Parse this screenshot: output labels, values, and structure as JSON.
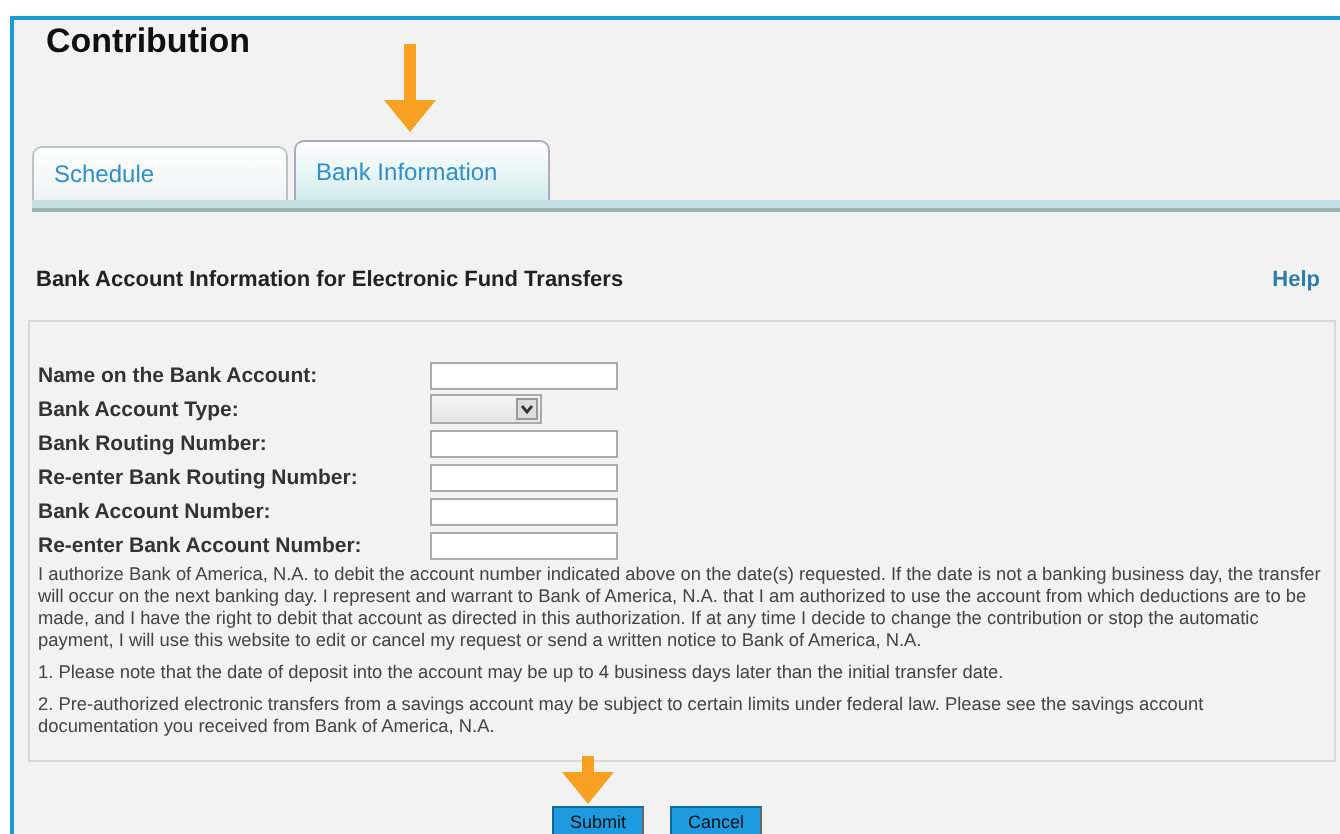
{
  "page": {
    "title": "Contribution"
  },
  "tabs": [
    {
      "label": "Schedule",
      "selected": false
    },
    {
      "label": "Bank Information",
      "selected": true
    }
  ],
  "section": {
    "heading": "Bank Account Information for Electronic Fund Transfers",
    "help": "Help"
  },
  "fields": [
    {
      "label": "Name on the Bank Account:",
      "kind": "text"
    },
    {
      "label": "Bank Account Type:",
      "kind": "select"
    },
    {
      "label": "Bank Routing Number:",
      "kind": "text"
    },
    {
      "label": "Re-enter Bank Routing Number:",
      "kind": "text"
    },
    {
      "label": "Bank Account Number:",
      "kind": "text"
    },
    {
      "label": "Re-enter Bank Account Number:",
      "kind": "text"
    }
  ],
  "notes": [
    "I authorize Bank of America, N.A. to debit the account number indicated above on the date(s) requested. If the date is not a banking business day, the transfer will occur on the next banking day. I represent and warrant to Bank of America, N.A. that I am authorized to use the account from which deductions are to be made, and I have the right to debit that account as directed in this authorization. If at any time I decide to change the contribution or stop the automatic payment, I will use this website to edit or cancel my request or send a written notice to Bank of America, N.A.",
    "1. Please note that the date of deposit into the account may be up to 4 business days later than the initial transfer date.",
    "2. Pre-authorized electronic transfers from a savings account may be subject to certain limits under federal law. Please see the savings account documentation you received from Bank of America, N.A."
  ],
  "buttons": [
    "Submit",
    "Cancel"
  ]
}
